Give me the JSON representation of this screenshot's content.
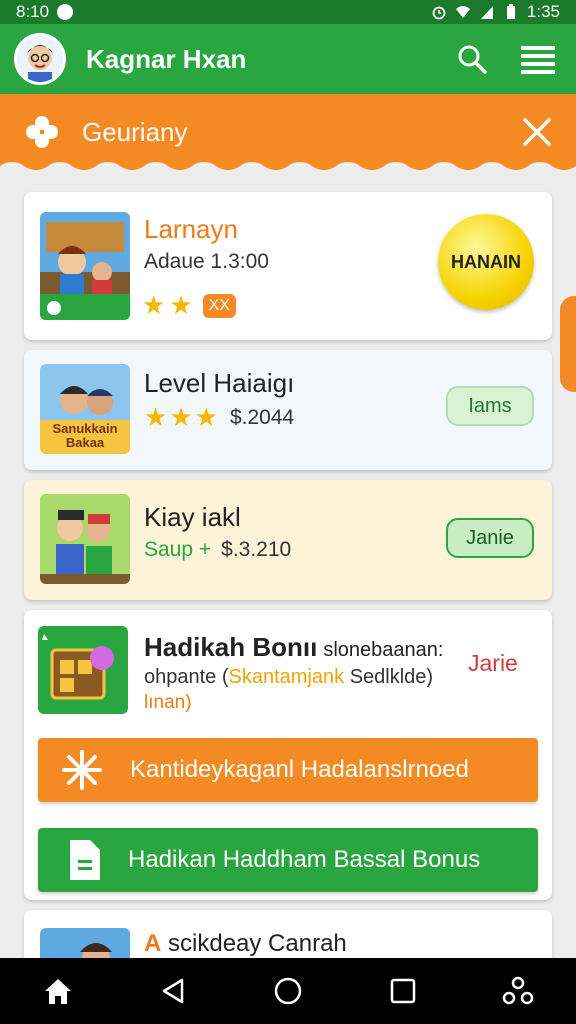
{
  "status_bar": {
    "time_left": "8:10",
    "time_right": "1:35"
  },
  "app_bar": {
    "title": "Kagnar Hxan"
  },
  "banner": {
    "title": "Geuriany"
  },
  "cards": [
    {
      "title": "Larnayn",
      "subtitle": "Adaue 1.3:00",
      "badge": "XX",
      "thumb_label": "",
      "action": "HANAIN"
    },
    {
      "title": "Level Haiaigı",
      "subtitle": "$.2044",
      "thumb_label": "Sanukkain Bakaa",
      "action": "Iams"
    },
    {
      "title": "Kiay iakl",
      "subtitle_prefix": "Saup +",
      "subtitle": "$.3.210",
      "action": "Janie"
    },
    {
      "title": "Hadikah Bonıı",
      "title_suffix": "slonebaanan:",
      "line2_prefix": "ohpante (",
      "line2_highlight": "Skantamjank",
      "line2_suffix": " Sedlklde)",
      "line3": "lınan)",
      "action": "Jarie"
    },
    {
      "title_prefix": "A",
      "title": " scikdeay Canrah"
    }
  ],
  "buttons": {
    "orange": "Kantideykaganl Hadalanslrnoed",
    "green": "Hadikan Haddham Bassal Bonus"
  },
  "colors": {
    "green": "#2aa640",
    "dark_green": "#1b7a2c",
    "orange": "#f48a24",
    "yellow": "#f5d400"
  }
}
